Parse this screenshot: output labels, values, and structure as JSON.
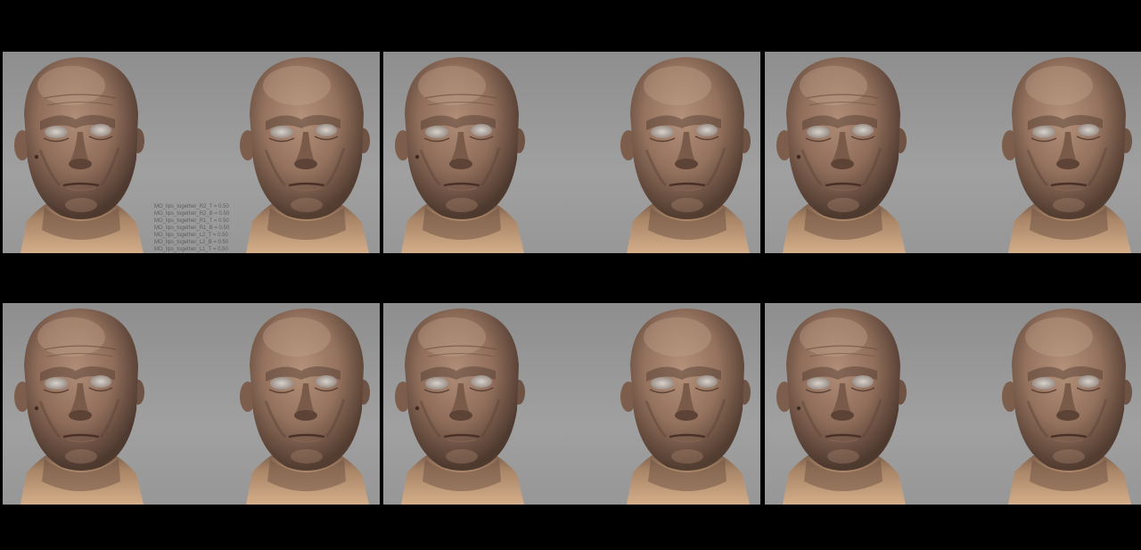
{
  "panels": [
    {
      "id": "r1c1",
      "overlay_lines": [
        "MO_lips_together_R2_T = 0.50",
        "MO_lips_together_R2_B = 0.50",
        "MO_lips_together_R1_T = 0.50",
        "MO_lips_together_R1_B = 0.50",
        "MO_lips_together_L2_T = 0.50",
        "MO_lips_together_L2_B = 0.50",
        "MO_lips_together_L1_T = 0.50"
      ]
    },
    {
      "id": "r1c2",
      "overlay_lines": []
    },
    {
      "id": "r1c3",
      "overlay_lines": []
    },
    {
      "id": "r2c1",
      "overlay_lines": []
    },
    {
      "id": "r2c2",
      "overlay_lines": []
    },
    {
      "id": "r2c3",
      "overlay_lines": []
    }
  ],
  "colors": {
    "background": "#000000",
    "viewport": "#9a9a9a",
    "skin_face": "#9c7a66",
    "skin_neck": "#c9a27f",
    "overlay_text": "#5e5e5e"
  },
  "icons": {
    "head_left": "old-man-head-render",
    "head_right": "younger-man-head-render"
  }
}
